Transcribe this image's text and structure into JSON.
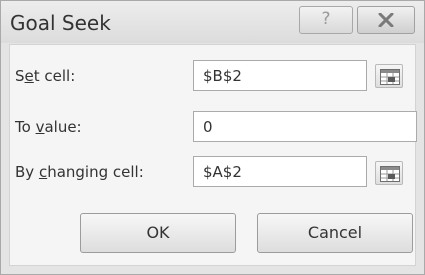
{
  "window": {
    "title": "Goal Seek",
    "help_glyph": "?",
    "close_icon": "close-x-icon"
  },
  "form": {
    "set_cell": {
      "label_pre": "S",
      "label_key": "e",
      "label_post": "t cell:",
      "value": "$B$2",
      "picker_icon": "range-picker-icon"
    },
    "to_value": {
      "label_pre": "To ",
      "label_key": "v",
      "label_post": "alue:",
      "value": "0"
    },
    "by_changing_cell": {
      "label_pre": "By ",
      "label_key": "c",
      "label_post": "hanging cell:",
      "value": "$A$2",
      "picker_icon": "range-picker-icon"
    }
  },
  "buttons": {
    "ok": "OK",
    "cancel": "Cancel"
  },
  "colors": {
    "close_glyph": "#7a7a7a"
  }
}
